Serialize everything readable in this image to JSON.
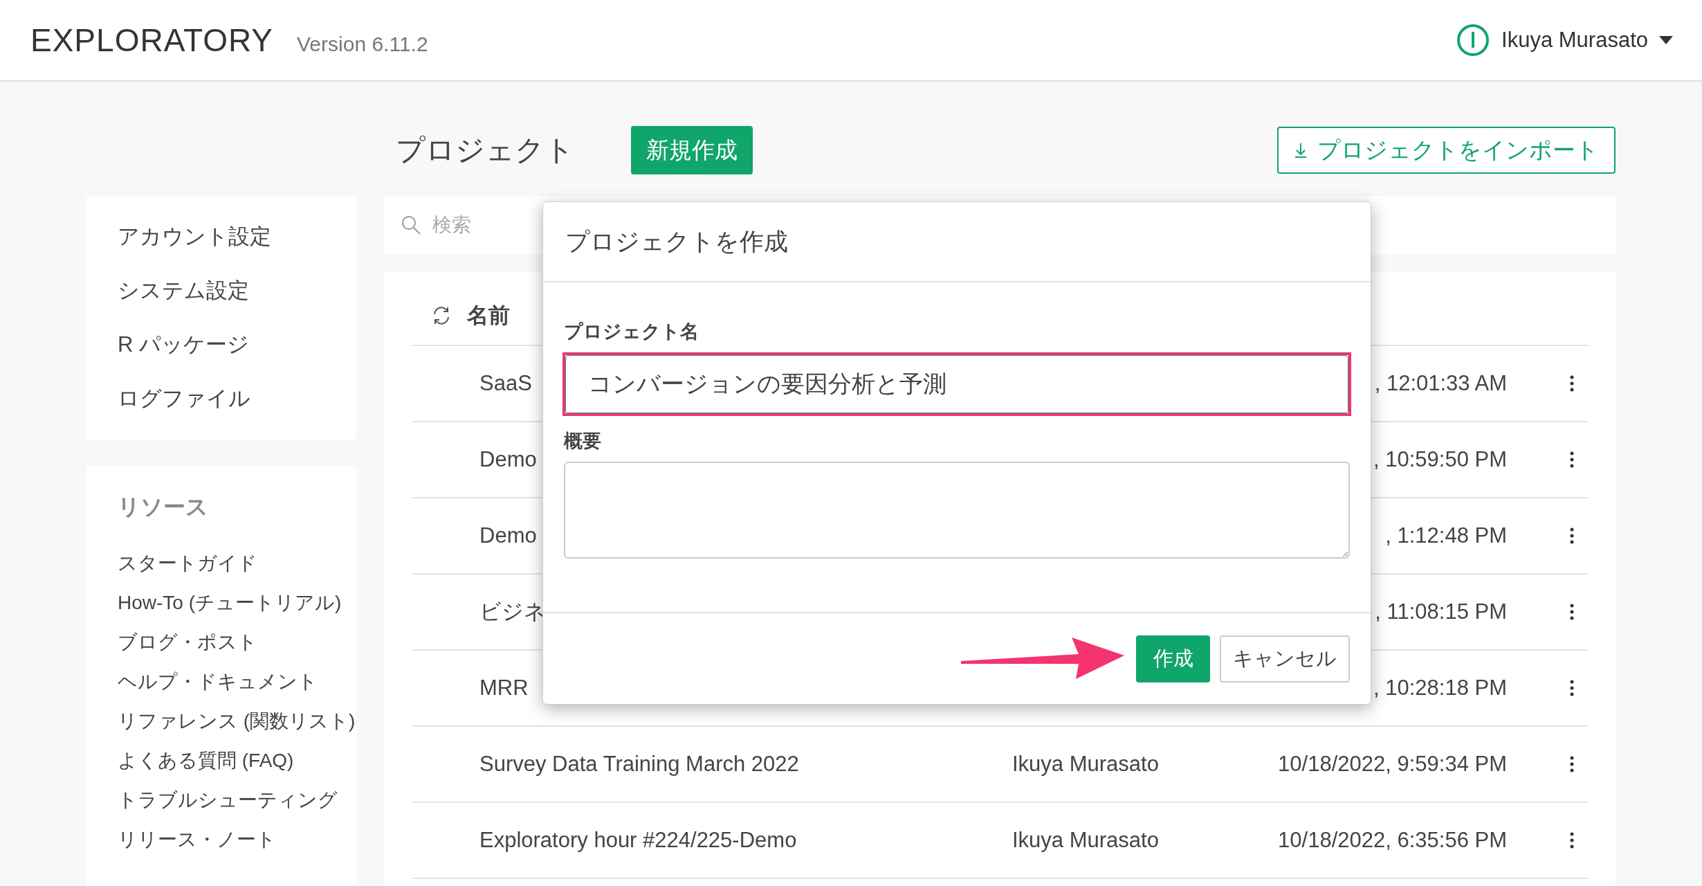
{
  "header": {
    "logo": "EXPLORATORY",
    "version": "Version 6.11.2",
    "user": "Ikuya Murasato"
  },
  "page": {
    "title": "プロジェクト",
    "new_button": "新規作成",
    "import_button": "プロジェクトをインポート"
  },
  "sidebar": {
    "settings": [
      {
        "label": "アカウント設定"
      },
      {
        "label": "システム設定"
      },
      {
        "label": "R パッケージ"
      },
      {
        "label": "ログファイル"
      }
    ],
    "resources_title": "リソース",
    "resources": [
      {
        "label": "スタートガイド"
      },
      {
        "label": "How-To (チュートリアル)"
      },
      {
        "label": "ブログ・ポスト"
      },
      {
        "label": "ヘルプ・ドキュメント"
      },
      {
        "label": "リファレンス (関数リスト)"
      },
      {
        "label": "よくある質問 (FAQ)"
      },
      {
        "label": "トラブルシューティング"
      },
      {
        "label": "リリース・ノート"
      }
    ]
  },
  "search": {
    "placeholder": "検索"
  },
  "table": {
    "columns": [
      {
        "label": "名前"
      }
    ],
    "rows": [
      {
        "name": "SaaS",
        "updated": ", 12:01:33 AM"
      },
      {
        "name": "Demo",
        "updated": ", 10:59:50 PM"
      },
      {
        "name": "Demo",
        "updated": ", 1:12:48 PM"
      },
      {
        "name": "ビジネ",
        "updated": ", 11:08:15 PM"
      },
      {
        "name": "MRR",
        "updated": ", 10:28:18 PM"
      },
      {
        "name": "Survey Data Training March 2022",
        "owner": "Ikuya Murasato",
        "updated": "10/18/2022, 9:59:34 PM"
      },
      {
        "name": "Exploratory hour #224/225-Demo",
        "owner": "Ikuya Murasato",
        "updated": "10/18/2022, 6:35:56 PM"
      }
    ]
  },
  "dialog": {
    "title": "プロジェクトを作成",
    "name_label": "プロジェクト名",
    "name_value": "コンバージョンの要因分析と予測",
    "summary_label": "概要",
    "create_button": "作成",
    "cancel_button": "キャンセル",
    "name_field_highlighted": true,
    "create_button_arrow": true
  }
}
